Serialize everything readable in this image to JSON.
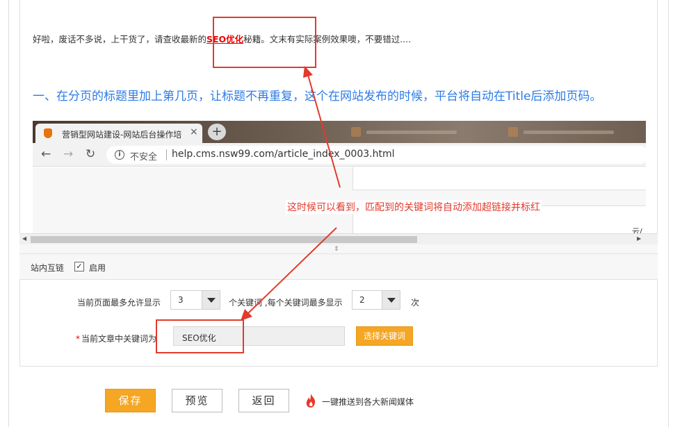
{
  "article": {
    "intro_before": "好啦，废话不多说，上干货了，请查收最新的",
    "intro_keyword": "SEO优化",
    "intro_after": "秘籍。文末有实际案例效果噢，不要错过....",
    "heading": "一、在分页的标题里加上第几页，让标题不再重复，这个在网站发布的时候，平台将自动在Title后添加页码。"
  },
  "browser": {
    "tab_title": "营销型网站建设-网站后台操作培",
    "tab_close": "×",
    "new_tab": "+",
    "insecure_label": "不安全",
    "url": "help.cms.nsw99.com/article_index_0003.html",
    "snippet": "云/"
  },
  "annotation": {
    "callout": "这时候可以看到，匹配到的关键词将自动添加超链接并标红",
    "color": "#e23a2c"
  },
  "settings": {
    "internal_link_label": "站内互链",
    "enable_label": "启用",
    "enabled": true,
    "checkmark": "✓",
    "max_keywords_label": "当前页面最多允许显示",
    "max_keywords_value": "3",
    "per_keyword_label": "个关键词 ,每个关键词最多显示",
    "per_keyword_value": "2",
    "times_label": "次",
    "required_mark": "*",
    "current_keywords_label": "当前文章中关键词为",
    "current_keywords_value": "SEO优化",
    "choose_keywords_button": "选择关键词"
  },
  "actions": {
    "save": "保存",
    "preview": "预览",
    "back": "返回",
    "push_text": "一键推送到各大新闻媒体"
  },
  "colors": {
    "accent": "#f5a623",
    "link_red": "#e00000",
    "heading_blue": "#2d7be5"
  }
}
